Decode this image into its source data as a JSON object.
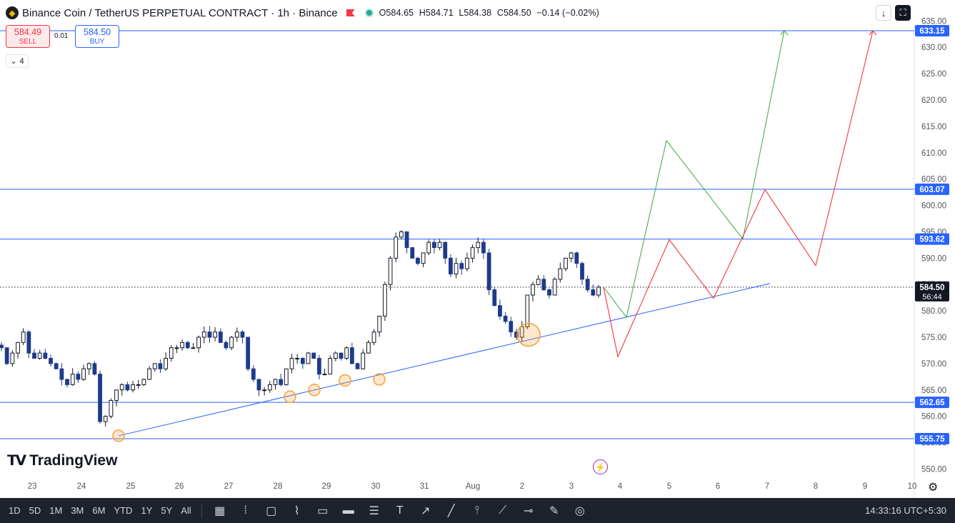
{
  "header": {
    "title": "Binance Coin / TetherUS PERPETUAL CONTRACT · 1h · Binance",
    "ohlc": {
      "o": "O584.65",
      "h": "H584.71",
      "l": "L584.38",
      "c": "C584.50",
      "chg": "−0.14 (−0.02%)"
    }
  },
  "trade": {
    "sell_price": "584.49",
    "sell_label": "SELL",
    "spread": "0.01",
    "buy_price": "584.50",
    "buy_label": "BUY"
  },
  "indicators_count": "4",
  "watermark": "TradingView",
  "bottom": {
    "timeframes": [
      "1D",
      "5D",
      "1M",
      "3M",
      "6M",
      "YTD",
      "1Y",
      "5Y",
      "All"
    ],
    "clock": "14:33:16 UTC+5:30"
  },
  "colors": {
    "up": "#131722",
    "down": "#1e3a8a",
    "hline": "#2962ff",
    "green": "#4caf50",
    "red": "#f23645",
    "circle": "#f7a035"
  },
  "chart_data": {
    "type": "candlestick",
    "symbol": "BNBUSDT.P",
    "interval": "1h",
    "ylim": [
      547,
      636
    ],
    "y_ticks": [
      550,
      555,
      560,
      565,
      570,
      575,
      580,
      585,
      590,
      595,
      600,
      605,
      610,
      615,
      620,
      625,
      630,
      635
    ],
    "x_ticks": [
      "23",
      "24",
      "25",
      "26",
      "27",
      "28",
      "29",
      "30",
      "31",
      "Aug",
      "2",
      "3",
      "4",
      "5",
      "6",
      "7",
      "8",
      "9",
      "10"
    ],
    "last_price": {
      "value": 584.5,
      "label": "584.50",
      "countdown": "56:44"
    },
    "horizontal_levels": [
      {
        "value": 633.15,
        "label": "633.15"
      },
      {
        "value": 603.07,
        "label": "603.07"
      },
      {
        "value": 593.62,
        "label": "593.62"
      },
      {
        "value": 562.65,
        "label": "562.65"
      },
      {
        "value": 555.75,
        "label": "555.75"
      }
    ],
    "trendline": {
      "from": {
        "x": "24.7",
        "y": 556.3
      },
      "to": {
        "x": "4.6",
        "y": 585.2
      }
    },
    "price_path_close": [
      573,
      570,
      572,
      574,
      576,
      572,
      571,
      572,
      571,
      570,
      569,
      567,
      566,
      568,
      567,
      569,
      570,
      568,
      559,
      560,
      563,
      565,
      566,
      565,
      566,
      566,
      567,
      569,
      570,
      569,
      571,
      573,
      573,
      574,
      573,
      573,
      575,
      576,
      575,
      576,
      574,
      573,
      575,
      576,
      575,
      569,
      567,
      565,
      565,
      566,
      567,
      566,
      569,
      571,
      571,
      570,
      572,
      571,
      568,
      568,
      571,
      572,
      571,
      573,
      570,
      569,
      572,
      574,
      576,
      579,
      585,
      590,
      594,
      595,
      592,
      590,
      589,
      591,
      593,
      592,
      593,
      590,
      587,
      589,
      588,
      590,
      592,
      593,
      591,
      584,
      581,
      579,
      578,
      576,
      575,
      577,
      583,
      585,
      586,
      584,
      583,
      586,
      588,
      590,
      591,
      589,
      586,
      584,
      583,
      584.5
    ],
    "support_touches": [
      {
        "x": "24.7",
        "y": 556.3
      },
      {
        "x": "28.3",
        "y": 563.7
      },
      {
        "x": "28.8",
        "y": 565.0
      },
      {
        "x": "29.4",
        "y": 566.8
      },
      {
        "x": "30.1",
        "y": 567.0
      },
      {
        "x": "2.2",
        "y": 575.2
      }
    ],
    "projections": [
      {
        "name": "bullish",
        "color": "#4caf50",
        "points": [
          [
            584.5
          ],
          [
            578.8
          ],
          [
            612.3
          ],
          [
            593.6
          ],
          [
            633.15
          ]
        ]
      },
      {
        "name": "bearish",
        "color": "#f23645",
        "points": [
          [
            584.5
          ],
          [
            571.3
          ],
          [
            593.5
          ],
          [
            582.4
          ],
          [
            603.0
          ],
          [
            588.6
          ],
          [
            633.15
          ]
        ]
      }
    ]
  }
}
